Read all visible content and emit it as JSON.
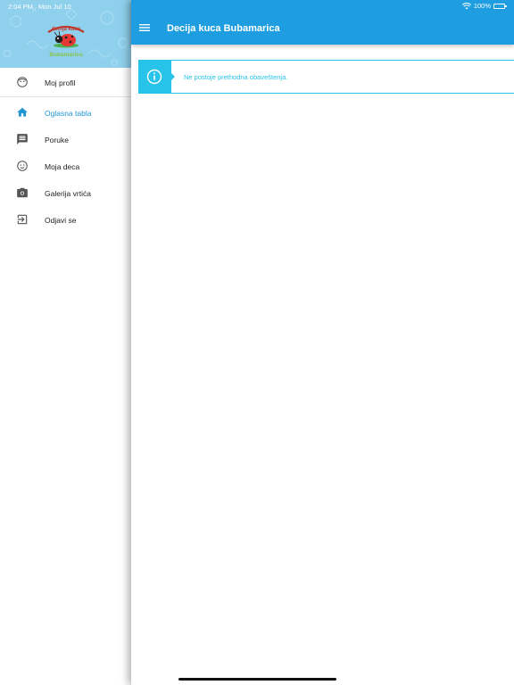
{
  "status_bar": {
    "time": "2:04 PM",
    "date": "Mon Jul 10",
    "battery": "100%",
    "battery_level": 1.0
  },
  "header": {
    "title": "Decija kuca Bubamarica",
    "menu_icon": "hamburger-icon"
  },
  "sidebar": {
    "logo_icon": "ladybug-logo",
    "profile": {
      "label": "Moj profil",
      "icon": "face-icon"
    },
    "items": [
      {
        "label": "Oglasna tabla",
        "icon": "home-icon",
        "active": true
      },
      {
        "label": "Poruke",
        "icon": "message-icon",
        "active": false
      },
      {
        "label": "Moja deca",
        "icon": "child-icon",
        "active": false
      },
      {
        "label": "Galerija vrtića",
        "icon": "camera-icon",
        "active": false
      },
      {
        "label": "Odjavi se",
        "icon": "logout-icon",
        "active": false
      }
    ]
  },
  "notice": {
    "icon": "info-icon",
    "text": "Ne postoje prethodna obaveštenja."
  },
  "colors": {
    "primary": "#1e9ee0",
    "active_nav": "#2196d3",
    "info": "#27c3e9",
    "sidebar_header": "#8fd0ec"
  }
}
